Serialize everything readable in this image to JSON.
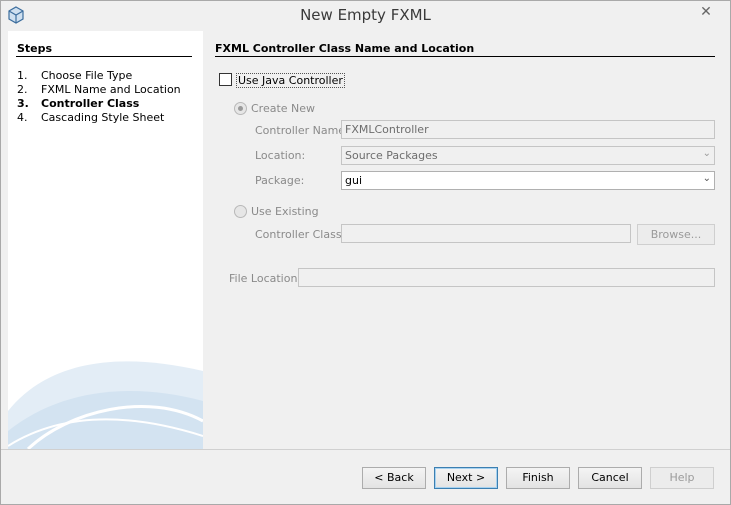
{
  "window": {
    "title": "New Empty FXML",
    "close_glyph": "✕"
  },
  "steps": {
    "title": "Steps",
    "items": [
      {
        "num": "1.",
        "label": "Choose File Type"
      },
      {
        "num": "2.",
        "label": "FXML Name and Location"
      },
      {
        "num": "3.",
        "label": "Controller Class"
      },
      {
        "num": "4.",
        "label": "Cascading Style Sheet"
      }
    ],
    "current_index": 2
  },
  "content": {
    "title": "FXML Controller Class Name and Location",
    "use_java_controller": {
      "label": "Use Java Controller",
      "checked": false
    },
    "create_new": {
      "label": "Create New",
      "selected": true
    },
    "controller_name": {
      "label": "Controller Name:",
      "value": "FXMLController"
    },
    "location": {
      "label": "Location:",
      "value": "Source Packages"
    },
    "package": {
      "label": "Package:",
      "value": "gui"
    },
    "use_existing": {
      "label": "Use Existing",
      "selected": false
    },
    "controller_class": {
      "label": "Controller Class:",
      "value": ""
    },
    "browse_label": "Browse...",
    "file_location": {
      "label": "File Location:",
      "value": ""
    }
  },
  "buttons": {
    "back": "< Back",
    "next": "Next >",
    "finish": "Finish",
    "cancel": "Cancel",
    "help": "Help"
  },
  "icons": {
    "app": "netbeans-cube-icon",
    "dropdown": "chevron-down-icon",
    "close": "close-icon"
  }
}
